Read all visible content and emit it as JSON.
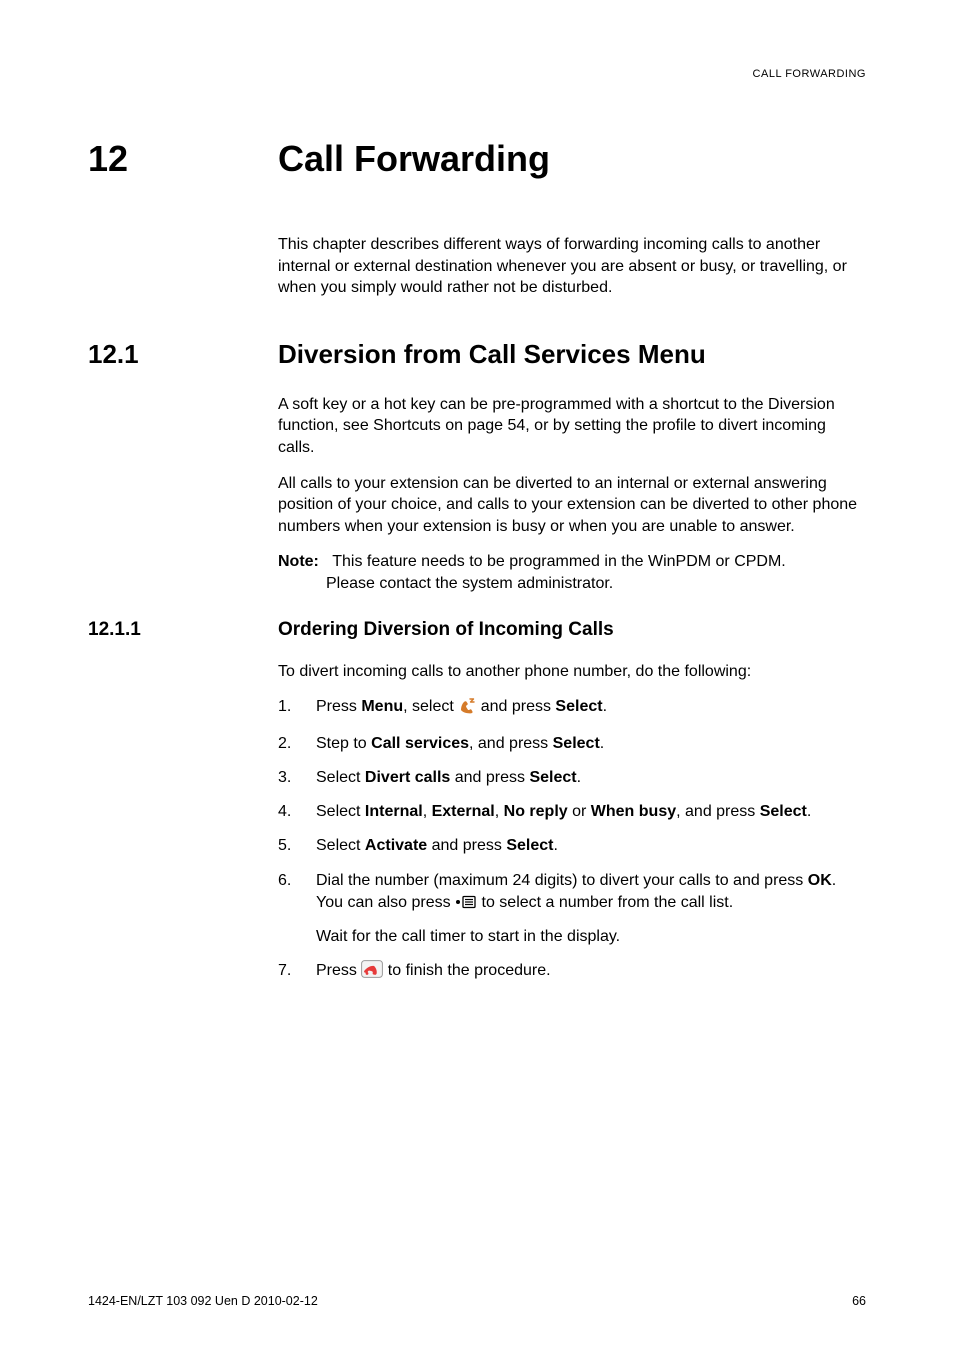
{
  "running_header": "CALL FORWARDING",
  "chapter": {
    "num": "12",
    "title": "Call Forwarding",
    "intro": "This chapter describes different ways of forwarding incoming calls to another internal or external destination whenever you are absent or busy, or travelling, or when you simply would rather not be disturbed."
  },
  "section": {
    "num": "12.1",
    "title": "Diversion from Call Services Menu",
    "p1": "A soft key or a hot key can be pre-programmed with a shortcut to the Diversion function, see Shortcuts on page 54, or by setting the profile to divert incoming calls.",
    "p2": "All calls to your extension can be diverted to an internal or external answering position of your choice, and calls to your extension can be diverted to other phone numbers when your extension is busy or when you are unable to answer.",
    "note_label": "Note:",
    "note_text_l1": "This feature needs to be programmed in the WinPDM or CPDM.",
    "note_text_l2": "Please contact the system administrator."
  },
  "subsection": {
    "num": "12.1.1",
    "title": "Ordering Diversion of Incoming Calls",
    "lead": "To divert incoming calls to another phone number, do the following:",
    "steps": {
      "s1": {
        "num": "1.",
        "pre": "Press ",
        "b1": "Menu",
        "mid1": ", select ",
        "icon": "phone-settings-icon",
        "mid2": " and press ",
        "b2": "Select",
        "post": "."
      },
      "s2": {
        "num": "2.",
        "pre": "Step to ",
        "b1": "Call services",
        "mid": ", and press ",
        "b2": "Select",
        "post": "."
      },
      "s3": {
        "num": "3.",
        "pre": "Select ",
        "b1": "Divert calls",
        "mid": " and press ",
        "b2": "Select",
        "post": "."
      },
      "s4": {
        "num": "4.",
        "pre": "Select ",
        "b1": "Internal",
        "c1": ", ",
        "b2": "External",
        "c2": ", ",
        "b3": "No reply",
        "c3": " or ",
        "b4": "When busy",
        "c4": ", and press ",
        "b5": "Select",
        "post": "."
      },
      "s5": {
        "num": "5.",
        "pre": "Select ",
        "b1": "Activate",
        "mid": " and press ",
        "b2": "Select",
        "post": "."
      },
      "s6": {
        "num": "6.",
        "pre": "Dial the number (maximum 24 digits) to divert your calls to and press ",
        "b1": "OK",
        "mid": ". You can also press  ",
        "icon": "call-list-icon",
        "post": "  to select a number from the call list.",
        "sub": "Wait for the call timer to start in the display."
      },
      "s7": {
        "num": "7.",
        "pre": "Press ",
        "icon": "end-call-icon",
        "post": " to finish the procedure."
      }
    }
  },
  "footer": {
    "left": "1424-EN/LZT 103 092 Uen D 2010-02-12",
    "right": "66"
  }
}
